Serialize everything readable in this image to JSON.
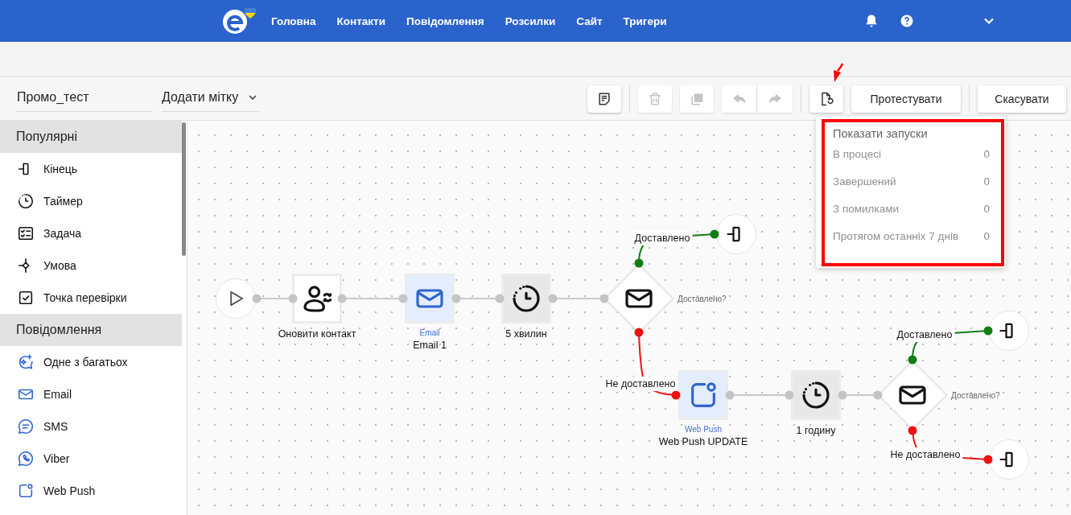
{
  "header": {
    "nav": [
      {
        "label": "Головна"
      },
      {
        "label": "Контакти"
      },
      {
        "label": "Повідомлення"
      },
      {
        "label": "Розсилки"
      },
      {
        "label": "Сайт"
      },
      {
        "label": "Тригери"
      }
    ]
  },
  "toolbar": {
    "campaign_name": "Промо_тест",
    "tag_dropdown": "Додати мітку",
    "tools": [
      {
        "kind": "note",
        "disabled": false
      },
      {
        "kind": "trash",
        "disabled": true
      },
      {
        "kind": "copy",
        "disabled": true
      },
      {
        "kind": "undo",
        "disabled": true
      },
      {
        "kind": "redo",
        "disabled": true
      },
      {
        "kind": "launches",
        "disabled": false
      }
    ],
    "test_button": "Протестувати",
    "cancel_button": "Скасувати"
  },
  "launches_popup": {
    "title": "Показати запуски",
    "rows": [
      {
        "label": "В процесі",
        "count": "0"
      },
      {
        "label": "Завершений",
        "count": "0"
      },
      {
        "label": "З помилками",
        "count": "0"
      },
      {
        "label": "Протягом останніх 7 днів",
        "count": "0"
      }
    ]
  },
  "sidebar": {
    "sections": [
      {
        "title": "Популярні",
        "items": [
          {
            "kind": "end",
            "label": "Кінець"
          },
          {
            "kind": "timer",
            "label": "Таймер"
          },
          {
            "kind": "task",
            "label": "Задача"
          },
          {
            "kind": "condition",
            "label": "Умова"
          },
          {
            "kind": "checkpoint",
            "label": "Точка перевірки"
          }
        ]
      },
      {
        "title": "Повідомлення",
        "items": [
          {
            "kind": "multi",
            "label": "Одне з багатьох"
          },
          {
            "kind": "email",
            "label": "Email"
          },
          {
            "kind": "sms",
            "label": "SMS"
          },
          {
            "kind": "viber",
            "label": "Viber"
          },
          {
            "kind": "webpush",
            "label": "Web Push"
          }
        ]
      }
    ]
  },
  "canvas": {
    "nodes": [
      {
        "kind": "start"
      },
      {
        "kind": "action",
        "label": "Оновити контакт"
      },
      {
        "kind": "email",
        "type_label": "Email",
        "label": "Email 1"
      },
      {
        "kind": "timer",
        "label": "5 хвилин"
      },
      {
        "kind": "condition",
        "question": "Доставлено?"
      },
      {
        "kind": "end"
      },
      {
        "kind": "webpush",
        "type_label": "Web Push",
        "label": "Web Push UPDATE"
      },
      {
        "kind": "timer",
        "label": "1 годину"
      },
      {
        "kind": "condition",
        "question": "Доставлено?"
      },
      {
        "kind": "end"
      },
      {
        "kind": "end"
      }
    ],
    "branches": [
      {
        "kind": "delivered",
        "label": "Доставлено"
      },
      {
        "kind": "failed",
        "label": "Не доставлено"
      },
      {
        "kind": "delivered",
        "label": "Доставлено"
      },
      {
        "kind": "failed",
        "label": "Не доставлено"
      }
    ]
  }
}
